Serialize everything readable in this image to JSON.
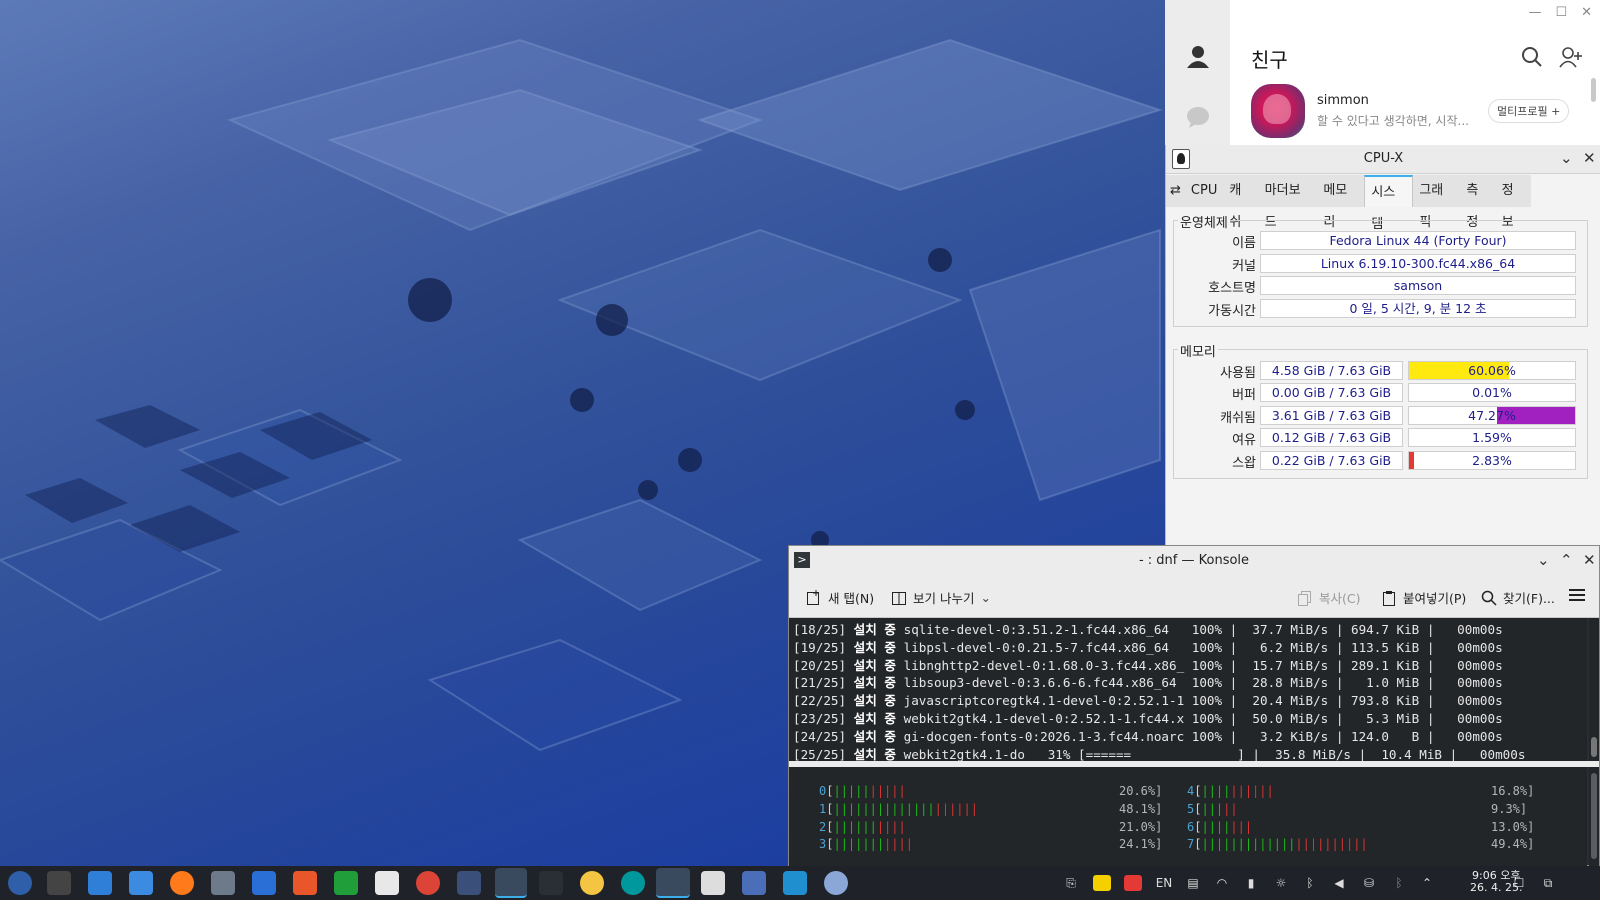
{
  "talk": {
    "title": "친구",
    "friend_name": "simmon",
    "friend_status": "할 수 있다고 생각하면, 시작...",
    "multi_profile": "멀티프로필 +"
  },
  "cpux": {
    "title": "CPU-X",
    "tabs": [
      "CPU",
      "캐쉬",
      "마더보드",
      "메모리",
      "시스템",
      "그래픽",
      "측정",
      "정보"
    ],
    "active_tab": "시스템",
    "os_group": "운영체제",
    "os": [
      {
        "label": "이름",
        "value": "Fedora Linux 44 (Forty Four)"
      },
      {
        "label": "커널",
        "value": "Linux 6.19.10-300.fc44.x86_64"
      },
      {
        "label": "호스트명",
        "value": "samson"
      },
      {
        "label": "가동시간",
        "value": "0 일, 5 시간, 9, 분 12 초"
      }
    ],
    "mem_group": "메모리",
    "mem": [
      {
        "label": "사용됨",
        "value": "4.58 GiB / 7.63 GiB",
        "pct": "60.06%",
        "frac": 0.6006,
        "color": "#ffe90f",
        "from": "left"
      },
      {
        "label": "버퍼",
        "value": "0.00 GiB / 7.63 GiB",
        "pct": "0.01%",
        "frac": 0.0001,
        "color": "#f2c500",
        "from": "left"
      },
      {
        "label": "캐쉬됨",
        "value": "3.61 GiB / 7.63 GiB",
        "pct": "47.27%",
        "frac": 0.4727,
        "color": "#a020c0",
        "from": "right"
      },
      {
        "label": "여유",
        "value": "0.12 GiB / 7.63 GiB",
        "pct": "1.59%",
        "frac": 0.0159,
        "color": "#ffffff",
        "from": "left"
      },
      {
        "label": "스왑",
        "value": "0.22 GiB / 7.63 GiB",
        "pct": "2.83%",
        "frac": 0.0283,
        "color": "#e53935",
        "from": "left"
      }
    ]
  },
  "konsole": {
    "title": "- : dnf — Konsole",
    "new_tab": "새 탭(N)",
    "split_view": "보기 나누기",
    "copy": "복사(C)",
    "paste": "붙여넣기(P)",
    "find": "찾기(F)...",
    "installing_word": "설치 중",
    "lines": [
      {
        "idx": "[18/25]",
        "pkg": "sqlite-devel-0:3.51.2-1.fc44.x86_64  ",
        "pct": "100%",
        "bar": "",
        "speed": " 37.7 MiB/s",
        "size": "694.7 KiB",
        "time": "00m00s"
      },
      {
        "idx": "[19/25]",
        "pkg": "libpsl-devel-0:0.21.5-7.fc44.x86_64  ",
        "pct": "100%",
        "bar": "",
        "speed": "  6.2 MiB/s",
        "size": "113.5 KiB",
        "time": "00m00s"
      },
      {
        "idx": "[20/25]",
        "pkg": "libnghttp2-devel-0:1.68.0-3.fc44.x86_",
        "pct": "100%",
        "bar": "",
        "speed": " 15.7 MiB/s",
        "size": "289.1 KiB",
        "time": "00m00s"
      },
      {
        "idx": "[21/25]",
        "pkg": "libsoup3-devel-0:3.6.6-6.fc44.x86_64 ",
        "pct": "100%",
        "bar": "",
        "speed": " 28.8 MiB/s",
        "size": "  1.0 MiB",
        "time": "00m00s"
      },
      {
        "idx": "[22/25]",
        "pkg": "javascriptcoregtk4.1-devel-0:2.52.1-1",
        "pct": "100%",
        "bar": "",
        "speed": " 20.4 MiB/s",
        "size": "793.8 KiB",
        "time": "00m00s"
      },
      {
        "idx": "[23/25]",
        "pkg": "webkit2gtk4.1-devel-0:2.52.1-1.fc44.x",
        "pct": "100%",
        "bar": "",
        "speed": " 50.0 MiB/s",
        "size": "  5.3 MiB",
        "time": "00m00s"
      },
      {
        "idx": "[24/25]",
        "pkg": "gi-docgen-fonts-0:2026.1-3.fc44.noarc",
        "pct": "100%",
        "bar": "",
        "speed": "  3.2 KiB/s",
        "size": "124.0   B",
        "time": "00m00s"
      },
      {
        "idx": "[25/25]",
        "pkg": "webkit2gtk4.1-do ",
        "pct": " 31%",
        "bar": " [======              ]",
        "speed": " 35.8 MiB/s",
        "size": " 10.4 MiB",
        "time": "00m00s"
      }
    ],
    "cpus": [
      {
        "n": "0",
        "g": 5,
        "r": 5,
        "pct": "20.6%]"
      },
      {
        "n": "1",
        "g": 14,
        "r": 6,
        "pct": "48.1%]"
      },
      {
        "n": "2",
        "g": 6,
        "r": 4,
        "pct": "21.0%]"
      },
      {
        "n": "3",
        "g": 7,
        "r": 4,
        "pct": "24.1%]"
      },
      {
        "n": "4",
        "g": 4,
        "r": 6,
        "pct": "16.8%]"
      },
      {
        "n": "5",
        "g": 3,
        "r": 2,
        "pct": "9.3%]"
      },
      {
        "n": "6",
        "g": 4,
        "r": 3,
        "pct": "13.0%]"
      },
      {
        "n": "7",
        "g": 13,
        "r": 10,
        "pct": "49.4%]"
      }
    ]
  },
  "taskbar": {
    "lang": "EN",
    "time": "9:06 오후",
    "date": "26. 4. 25."
  }
}
